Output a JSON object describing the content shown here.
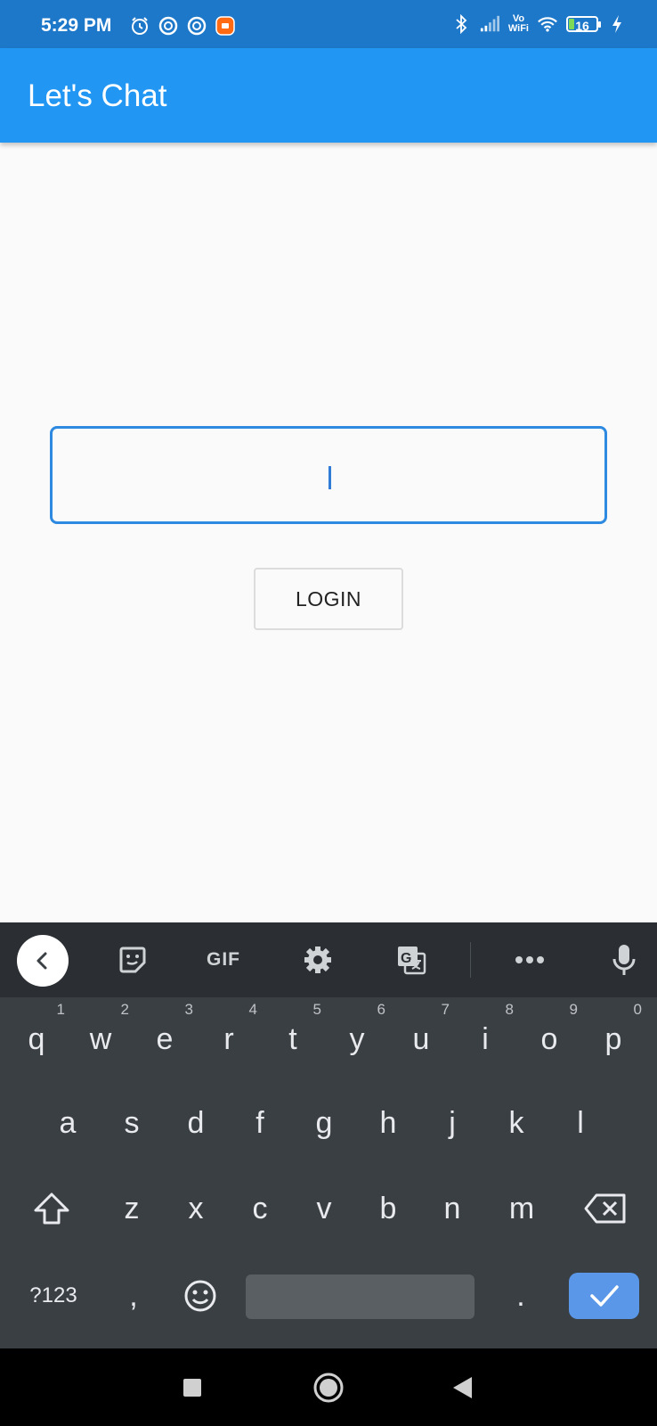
{
  "status_bar": {
    "time": "5:29 PM",
    "left_icons": [
      "alarm-icon",
      "app-notification-icon",
      "app-notification-icon",
      "mi-app-icon"
    ],
    "right_icons": [
      "bluetooth-icon",
      "signal-icon",
      "vowifi-icon",
      "wifi-icon",
      "battery-icon",
      "charging-icon"
    ],
    "vowifi_text": [
      "Vo",
      "WiFi"
    ],
    "battery_level": "16"
  },
  "app_bar": {
    "title": "Let's Chat",
    "color": "#2196f3"
  },
  "login_form": {
    "input_value": "",
    "input_focus_color": "#2d8ae0",
    "login_button_label": "LOGIN"
  },
  "keyboard": {
    "toolbar": {
      "gif_label": "GIF",
      "icons": [
        "back-icon",
        "sticker-icon",
        "gif-icon",
        "settings-icon",
        "translate-icon",
        "more-icon",
        "microphone-icon"
      ]
    },
    "row1": [
      {
        "key": "q",
        "hint": "1"
      },
      {
        "key": "w",
        "hint": "2"
      },
      {
        "key": "e",
        "hint": "3"
      },
      {
        "key": "r",
        "hint": "4"
      },
      {
        "key": "t",
        "hint": "5"
      },
      {
        "key": "y",
        "hint": "6"
      },
      {
        "key": "u",
        "hint": "7"
      },
      {
        "key": "i",
        "hint": "8"
      },
      {
        "key": "o",
        "hint": "9"
      },
      {
        "key": "p",
        "hint": "0"
      }
    ],
    "row2": [
      "a",
      "s",
      "d",
      "f",
      "g",
      "h",
      "j",
      "k",
      "l"
    ],
    "row3": [
      "z",
      "x",
      "c",
      "v",
      "b",
      "n",
      "m"
    ],
    "row4": {
      "symbols_label": "?123",
      "comma": ",",
      "period": "."
    },
    "enter_color": "#5b97e8"
  },
  "nav_bar": {
    "buttons": [
      "recents-button",
      "home-button",
      "back-button"
    ]
  }
}
